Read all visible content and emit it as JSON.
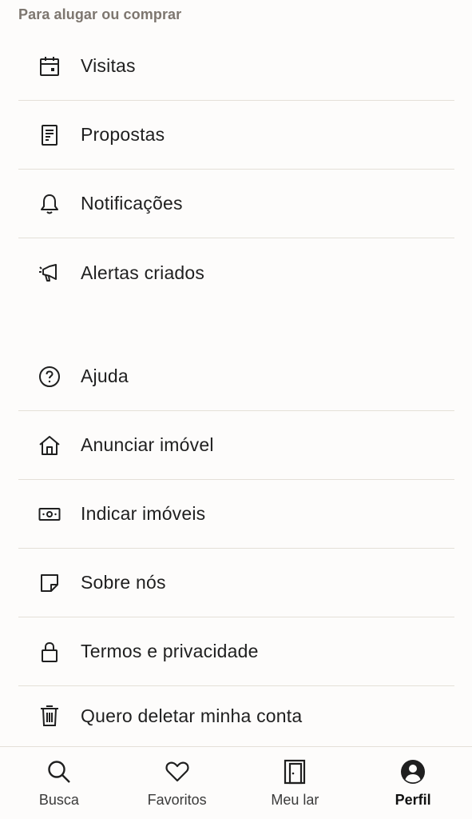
{
  "section": {
    "title": "Para alugar ou comprar"
  },
  "menu": {
    "group1": [
      {
        "label": "Visitas",
        "icon": "calendar-icon"
      },
      {
        "label": "Propostas",
        "icon": "document-icon"
      },
      {
        "label": "Notificações",
        "icon": "bell-icon"
      },
      {
        "label": "Alertas criados",
        "icon": "megaphone-icon"
      }
    ],
    "group2": [
      {
        "label": "Ajuda",
        "icon": "question-circle-icon"
      },
      {
        "label": "Anunciar imóvel",
        "icon": "house-icon"
      },
      {
        "label": "Indicar imóveis",
        "icon": "money-bill-icon"
      },
      {
        "label": "Sobre nós",
        "icon": "folded-square-icon"
      },
      {
        "label": "Termos e privacidade",
        "icon": "lock-icon"
      },
      {
        "label": "Quero deletar minha conta",
        "icon": "trash-icon"
      }
    ]
  },
  "bottom_nav": {
    "items": [
      {
        "label": "Busca",
        "icon": "search-icon"
      },
      {
        "label": "Favoritos",
        "icon": "heart-icon"
      },
      {
        "label": "Meu lar",
        "icon": "door-icon"
      },
      {
        "label": "Perfil",
        "icon": "user-circle-icon",
        "active": true
      }
    ]
  },
  "colors": {
    "background": "#fdfcfb",
    "divider": "#e4e0d8",
    "section_title": "#7d766f",
    "text": "#1f1f1f"
  }
}
